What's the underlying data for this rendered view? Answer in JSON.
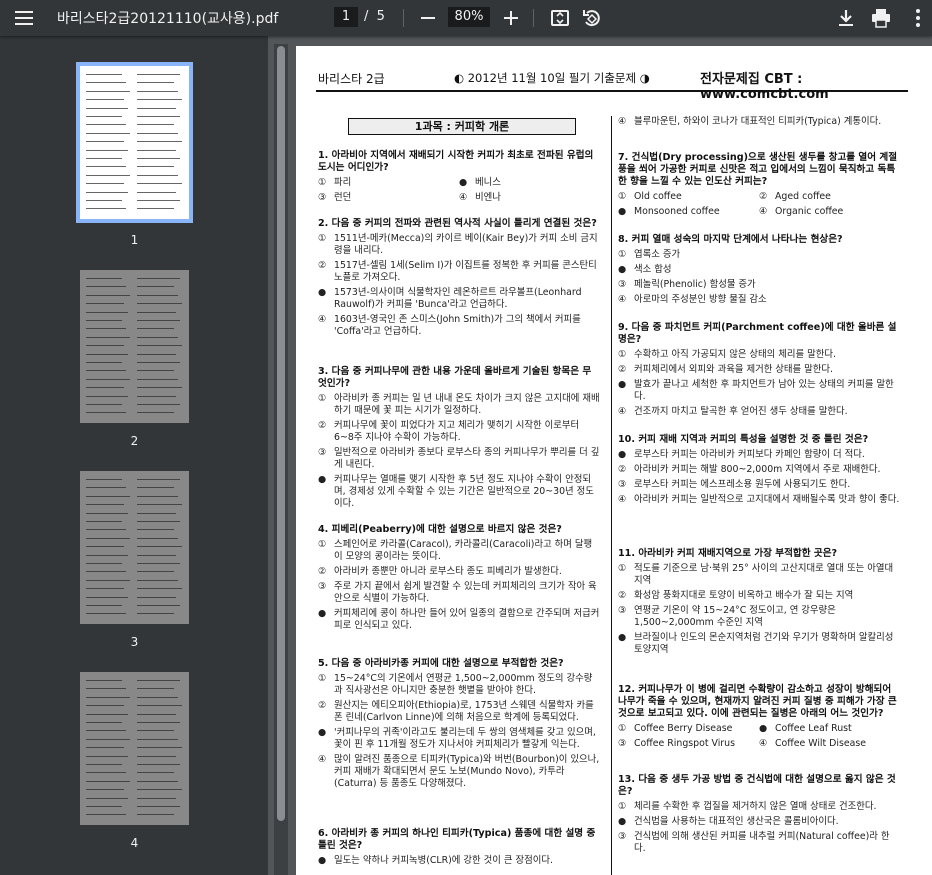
{
  "toolbar": {
    "title": "바리스타2급20121110(교사용).pdf",
    "page_current": "1",
    "page_sep": "/",
    "page_total": "5",
    "zoom": "80%"
  },
  "thumbnails": [
    {
      "num": "1"
    },
    {
      "num": "2"
    },
    {
      "num": "3"
    },
    {
      "num": "4"
    }
  ],
  "page": {
    "header_left": "바리스타 2급",
    "header_mid": "◐ 2012년 11월 10일 필기 기출문제 ◑",
    "header_right": "전자문제집 CBT : www.comcbt.com",
    "section": "1과목 : 커피학 개론",
    "left": [
      {
        "q": "1. 아라비아 지역에서 재배되기 시작한 커피가 최초로 전파된 유럽의 도시는 어디인가?",
        "layout": "grid",
        "opts": [
          {
            "m": "①",
            "t": "파리"
          },
          {
            "m": "●",
            "t": "베니스"
          },
          {
            "m": "③",
            "t": "런던"
          },
          {
            "m": "④",
            "t": "비엔나"
          }
        ]
      },
      {
        "q": "2. 다음 중 커피의 전파와 관련된 역사적 사실이 틀리게 연결된 것은?",
        "layout": "list",
        "opts": [
          {
            "m": "①",
            "t": "1511년-메카(Mecca)의 카이르 베이(Kair Bey)가 커피 소비 금지령을 내리다."
          },
          {
            "m": "②",
            "t": "1517년-셀림 1세(Selim I)가 이집트를 정복한 후 커피를 콘스탄티노플로 가져오다."
          },
          {
            "m": "●",
            "t": "1573년-의사이며 식물학자인 레온하르트 라우볼프(Leonhard Rauwolf)가 커피를 'Bunca'라고 언급하다."
          },
          {
            "m": "④",
            "t": "1603년-영국인 존 스미스(John Smith)가 그의 책에서 커피를 'Coffa'라고 언급하다."
          }
        ]
      },
      {
        "q": "3. 다음 중 커피나무에 관한 내용 가운데 올바르게 기술된 항목은 무엇인가?",
        "layout": "list",
        "opts": [
          {
            "m": "①",
            "t": "아라비카 종 커피는 일 년 내내 온도 차이가 크지 않은 고지대에 재배하기 때문에 꽃 피는 시기가 일정하다."
          },
          {
            "m": "②",
            "t": "커피나무에 꽃이 피었다가 지고 체리가 맺히기 시작한 이로부터 6~8주 지나야 수확이 가능하다."
          },
          {
            "m": "③",
            "t": "일반적으로 아라비카 종보다 로부스타 종의 커피나무가 뿌리를 더 깊게 내린다."
          },
          {
            "m": "●",
            "t": "커피나무는 열매를 맺기 시작한 후 5년 정도 지나야 수확이 안정되며, 경제성 있게 수확할 수 있는 기간은 일반적으로 20~30년 정도이다."
          }
        ]
      },
      {
        "q": "4. 피베리(Peaberry)에 대한 설명으로 바르지 않은 것은?",
        "layout": "list",
        "opts": [
          {
            "m": "①",
            "t": "스페인어로 카라콜(Caracol), 카라콜리(Caracoli)라고 하며 달팽이 모양의 콩이라는 뜻이다."
          },
          {
            "m": "②",
            "t": "아라비카 종뿐만 아니라 로부스타 종도 피베리가 발생한다."
          },
          {
            "m": "③",
            "t": "주로 가지 끝에서 쉽게 발견할 수 있는데 커피체리의 크기가 작아 육안으로 식별이 가능하다."
          },
          {
            "m": "●",
            "t": "커피체리에 콩이 하나만 들어 있어 일종의 결함으로 간주되며 저급커피로 인식되고 있다."
          }
        ]
      },
      {
        "q": "5. 다음 중 아라비카종 커피에 대한 설명으로 부적합한 것은?",
        "layout": "list",
        "opts": [
          {
            "m": "①",
            "t": "15~24°C의 기온에서 연평균 1,500~2,000mm 정도의 강수량과 직사광선은 아니지만 충분한 햇볕을 받아야 한다."
          },
          {
            "m": "②",
            "t": "원산지는 에티오피아(Ethiopia)로, 1753년 스웨덴 식물학자 카를 폰 린네(Carlvon Linne)에 의해 처음으로 학계에 등록되었다."
          },
          {
            "m": "●",
            "t": "'커피나무의 귀족'이라고도 불리는데 두 쌍의 염색체를 갖고 있으며, 꽃이 핀 후 11개월 정도가 지나서야 커피체리가 빨갛게 익는다."
          },
          {
            "m": "④",
            "t": "많이 알려진 품종으로 티피카(Typica)와 버번(Bourbon)이 있으나, 커피 재배가 확대되면서 문도 노보(Mundo Novo), 카투라(Caturra) 등 품종도 다양해졌다."
          }
        ]
      },
      {
        "q": "6. 아라비카 종 커피의 하나인 티피카(Typica) 품종에 대한 설명 중 틀린 것은?",
        "layout": "list",
        "opts": [
          {
            "m": "●",
            "t": "일도는 약하나 커피녹병(CLR)에 강한 것이 큰 장점이다."
          }
        ]
      }
    ],
    "right_continuation": {
      "m": "④",
      "t": "블루마운틴, 하와이 코나가 대표적인 티피카(Typica) 계통이다."
    },
    "right": [
      {
        "q": "7. 건식법(Dry processing)으로 생산된 생두를 창고를 열어 계절풍을 쐬어 가공한 커피로 신맛은 적고 입에서의 느낌이 묵직하고 독특한 향을 느낄 수 있는 인도산 커피는?",
        "layout": "grid",
        "opts": [
          {
            "m": "①",
            "t": "Old coffee"
          },
          {
            "m": "②",
            "t": "Aged coffee"
          },
          {
            "m": "●",
            "t": "Monsooned coffee"
          },
          {
            "m": "④",
            "t": "Organic coffee"
          }
        ]
      },
      {
        "q": "8. 커피 열매 성숙의 마지막 단계에서 나타나는 현상은?",
        "layout": "list",
        "opts": [
          {
            "m": "①",
            "t": "엽록소 증가"
          },
          {
            "m": "●",
            "t": "색소 합성"
          },
          {
            "m": "③",
            "t": "페놀릭(Phenolic) 함성물 증가"
          },
          {
            "m": "④",
            "t": "아로마의 주성분인 방향 물질 감소"
          }
        ]
      },
      {
        "q": "9. 다음 중 파치먼트 커피(Parchment coffee)에 대한 올바른 설명은?",
        "layout": "list",
        "opts": [
          {
            "m": "①",
            "t": "수확하고 아직 가공되지 않은 상태의 체리를 말한다."
          },
          {
            "m": "②",
            "t": "커피체리에서 외피와 과육을 제거한 상태를 말한다."
          },
          {
            "m": "●",
            "t": "발효가 끝나고 세척한 후 파치먼트가 남아 있는 상태의 커피를 말한다."
          },
          {
            "m": "④",
            "t": "건조까지 마치고 탈곡한 후 얻어진 생두 상태를 말한다."
          }
        ]
      },
      {
        "q": "10. 커피 재배 지역과 커피의 특성을 설명한 것 중 틀린 것은?",
        "layout": "list",
        "opts": [
          {
            "m": "●",
            "t": "로부스타 커피는 아라비카 커피보다 카페인 함량이 더 적다."
          },
          {
            "m": "②",
            "t": "아라비카 커피는 해발 800~2,000m 지역에서 주로 재배한다."
          },
          {
            "m": "③",
            "t": "로부스타 커피는 에스프레소용 원두에 사용되기도 한다."
          },
          {
            "m": "④",
            "t": "아라비카 커피는 일반적으로 고지대에서 재배될수록 맛과 향이 좋다."
          }
        ]
      },
      {
        "q": "11. 아라비카 커피 재배지역으로 가장 부적합한 곳은?",
        "layout": "list",
        "opts": [
          {
            "m": "①",
            "t": "적도를 기준으로 남·북위 25° 사이의 고산지대로 열대 또는 아열대지역"
          },
          {
            "m": "②",
            "t": "화성암 풍화지대로 토양이 비옥하고 배수가 잘 되는 지역"
          },
          {
            "m": "③",
            "t": "연평균 기온이 약 15~24°C 정도이고, 연 강우량은 1,500~2,000mm 수준인 지역"
          },
          {
            "m": "●",
            "t": "브라질이나 인도의 몬순지역처럼 건기와 우기가 명확하며 알칼리성 토양지역"
          }
        ]
      },
      {
        "q": "12. 커피나무가 이 병에 걸리면 수확량이 감소하고 성장이 방해되어 나무가 죽을 수 있으며, 현재까지 알려진 커피 질병 중 피해가 가장 큰 것으로 보고되고 있다. 이에 관련되는 질병은 아래의 어느 것인가?",
        "layout": "grid",
        "opts": [
          {
            "m": "①",
            "t": "Coffee Berry Disease"
          },
          {
            "m": "●",
            "t": "Coffee Leaf Rust"
          },
          {
            "m": "③",
            "t": "Coffee Ringspot Virus"
          },
          {
            "m": "④",
            "t": "Coffee Wilt Disease"
          }
        ]
      },
      {
        "q": "13. 다음 중 생두 가공 방법 중 건식법에 대한 설명으로 옳지 않은 것은?",
        "layout": "list",
        "opts": [
          {
            "m": "①",
            "t": "체리를 수확한 후 껍질을 제거하지 않은 열매 상태로 건조한다."
          },
          {
            "m": "●",
            "t": "건식법을 사용하는 대표적인 생산국은 콜롬비아이다."
          },
          {
            "m": "③",
            "t": "건식법에 의해 생산된 커피를 내추럴 커피(Natural coffee)라 한다."
          }
        ]
      }
    ]
  }
}
